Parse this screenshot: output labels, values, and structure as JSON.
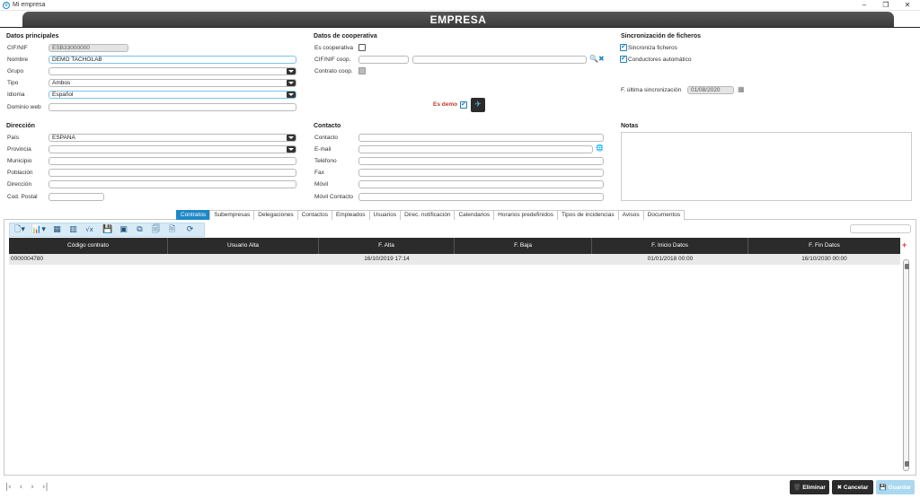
{
  "window": {
    "title": "Mi empresa",
    "minimize": "–",
    "restore": "❐",
    "close": "✕"
  },
  "header": {
    "title": "EMPRESA"
  },
  "datos_principales": {
    "title": "Datos principales",
    "cif_label": "CIF/NIF",
    "cif_value": "ESB33000000",
    "nombre_label": "Nombre",
    "nombre_value": "DEMO TACHOLAB",
    "grupo_label": "Grupo",
    "grupo_value": "",
    "tipo_label": "Tipo",
    "tipo_value": "Ambos",
    "idioma_label": "Idioma",
    "idioma_value": "Español",
    "dominio_label": "Dominio web",
    "dominio_value": ""
  },
  "cooperativa": {
    "title": "Datos de cooperativa",
    "es_coop_label": "Es cooperativa",
    "cif_coop_label": "CIF/NIF coop.",
    "contrato_label": "Contrato coop.",
    "search_icon": "🔍",
    "clear_icon": "✖"
  },
  "sincronizacion": {
    "title": "Sincronización de ficheros",
    "sincroniza_label": "Sincroniza ficheros",
    "conductores_label": "Conductores automático",
    "fecha_label": "F. última sincronización",
    "fecha_value": "01/08/2020",
    "calendar_icon": "▦"
  },
  "demo": {
    "label": "Es demo",
    "button_icon": "✈"
  },
  "direccion": {
    "title": "Dirección",
    "pais_label": "País",
    "pais_value": "ESPAÑA",
    "provincia_label": "Provincia",
    "municipio_label": "Municipio",
    "poblacion_label": "Población",
    "direccion_label": "Dirección",
    "cp_label": "Cod. Postal"
  },
  "contacto": {
    "title": "Contacto",
    "contacto_label": "Contacto",
    "email_label": "E-mail",
    "telefono_label": "Teléfono",
    "fax_label": "Fax",
    "movil_label": "Móvil",
    "movil_contacto_label": "Móvil Contacto",
    "globe_icon": "🌐"
  },
  "notas": {
    "title": "Notas"
  },
  "tabs": [
    "Contratos",
    "Subempresas",
    "Delegaciones",
    "Contactos",
    "Empleados",
    "Usuarios",
    "Direc. notificación",
    "Calendarios",
    "Horarios predefinidos",
    "Tipos de incidencias",
    "Avisos",
    "Documentos"
  ],
  "toolbar": {
    "icons": [
      "new-doc-icon",
      "chart-icon",
      "table-icon",
      "grid-icon",
      "formula-icon",
      "save-icon",
      "screen-icon",
      "export-icon",
      "copy-icon",
      "file-icon",
      "refresh-icon"
    ],
    "glyphs": [
      "🗋▾",
      "📊▾",
      "▦",
      "▥",
      "√x",
      "💾",
      "▣",
      "⧉",
      "🗐",
      "🗎",
      "⟳"
    ]
  },
  "table": {
    "columns": [
      "Código contrato",
      "Usuario Alta",
      "F. Alta",
      "F. Baja",
      "F. Inicio Datos",
      "F. Fin Datos"
    ],
    "rows": [
      [
        "0000004780",
        "",
        "16/10/2019 17:14",
        "",
        "01/01/2018 00:00",
        "16/10/2030 00:00"
      ]
    ],
    "add_icon": "+"
  },
  "nav": {
    "first": "|‹",
    "prev": "‹",
    "next": "›",
    "last": "›|"
  },
  "actions": {
    "eliminar": "Eliminar",
    "cancelar": "Cancelar",
    "guardar": "Guardar",
    "eliminar_icon": "🗑",
    "cancelar_icon": "✖",
    "guardar_icon": "💾",
    "colors": {
      "eliminar": "#2b2b2b",
      "cancelar": "#2b2b2b",
      "guardar": "#a9d8f0"
    }
  },
  "colors": {
    "accent": "#1e88c7",
    "header": "#3a3a3a",
    "demo": "#c0392b"
  }
}
